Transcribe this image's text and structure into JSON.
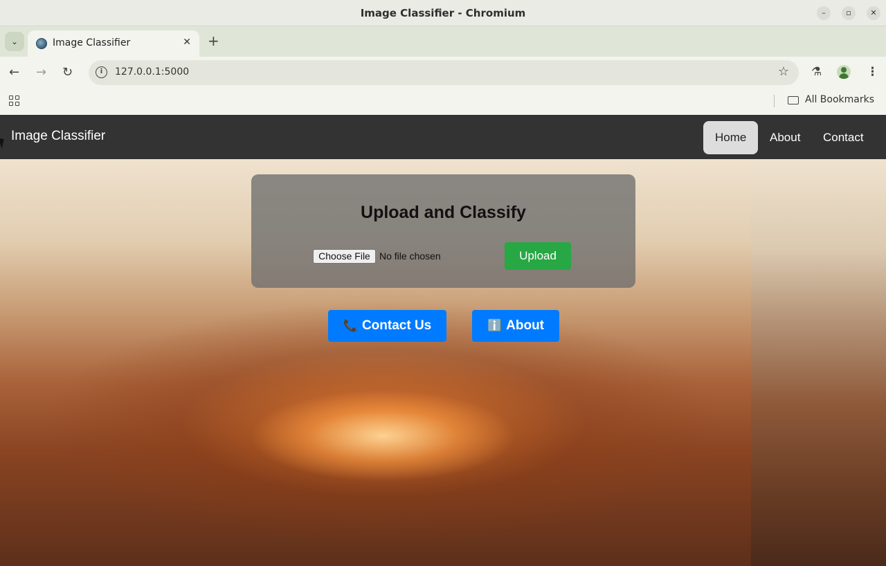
{
  "window": {
    "title": "Image Classifier - Chromium",
    "controls": {
      "minimize": "–",
      "maximize": "▫",
      "close": "✕"
    }
  },
  "tabs": [
    {
      "title": "Image Classifier",
      "close": "✕",
      "favicon": "globe-icon"
    }
  ],
  "tabstrip": {
    "menu_glyph": "⌄",
    "new_tab_glyph": "+"
  },
  "toolbar": {
    "back": "←",
    "forward": "→",
    "reload": "↻",
    "url": "127.0.0.1:5000",
    "info_glyph": "i",
    "bookmark_star": "☆",
    "labs_glyph": "⚗",
    "menu_glyph": "⋮"
  },
  "bookmarks_bar": {
    "all_bookmarks": "All Bookmarks"
  },
  "site": {
    "brand": "Image Classifier",
    "nav": [
      {
        "label": "Home",
        "active": true
      },
      {
        "label": "About",
        "active": false
      },
      {
        "label": "Contact",
        "active": false
      }
    ]
  },
  "upload_card": {
    "title": "Upload and Classify",
    "choose_file": "Choose File",
    "file_status": "No file chosen",
    "upload_button": "Upload"
  },
  "actions": {
    "contact": {
      "icon": "📞",
      "label": "Contact Us"
    },
    "about": {
      "icon": "ℹ️",
      "label": "About"
    }
  },
  "colors": {
    "navbar": "#333333",
    "upload_green": "#28a745",
    "action_blue": "#007bff",
    "active_nav_bg": "#dddddd"
  }
}
